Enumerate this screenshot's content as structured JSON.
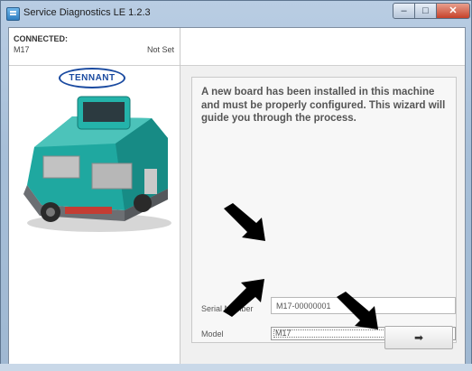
{
  "window": {
    "title": "Service Diagnostics LE 1.2.3",
    "controls": {
      "minimize": "–",
      "maximize": "□",
      "close": "✕"
    }
  },
  "connection": {
    "label": "CONNECTED:",
    "model": "M17",
    "status": "Not Set"
  },
  "brand": {
    "logo_text": "TENNANT",
    "accent": "#1a4aa0",
    "machine_color": "#1fa8a0"
  },
  "wizard": {
    "message": "A new board has been installed in this machine and must be properly configured. This wizard will guide you through the process.",
    "serial_label": "Serial Number",
    "serial_value": "M17-00000001",
    "model_label": "Model",
    "model_value": "M17",
    "next_icon": "arrow-right-icon",
    "next_glyph": "➡"
  }
}
